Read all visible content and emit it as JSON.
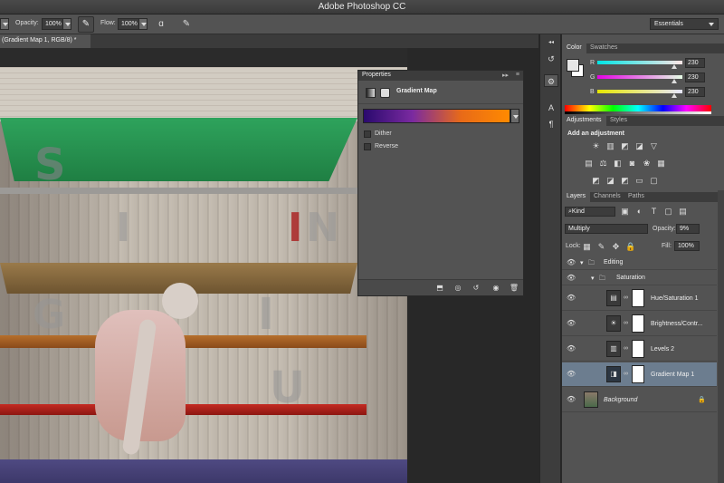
{
  "window": {
    "title": "Adobe Photoshop CC"
  },
  "options_bar": {
    "opacity_label": "Opacity:",
    "opacity_value": "100%",
    "flow_label": "Flow:",
    "flow_value": "100%",
    "workspace": "Essentials",
    "icons": [
      "airbrush-pressure-icon",
      "airbrush-icon",
      "tablet-size-icon"
    ]
  },
  "document": {
    "tab_label": "(Gradient Map 1, RGB/8) *"
  },
  "canvas": {
    "shelf_letters": [
      "S",
      "I",
      "N",
      "G",
      "I",
      "U"
    ],
    "colors": {
      "green_shelf": "#2ea35c",
      "red_shelf": "#c42a22",
      "floor": "#4f4a82"
    }
  },
  "properties": {
    "panel_title": "Properties",
    "adjustment_name": "Gradient Map",
    "gradient_colors": [
      "#2a0a6e",
      "#7a2aa0",
      "#e86a18",
      "#ff8a00"
    ],
    "dither_label": "Dither",
    "reverse_label": "Reverse",
    "dither_checked": false,
    "reverse_checked": false
  },
  "color_panel": {
    "tabs": [
      "Color",
      "Swatches"
    ],
    "channels": [
      {
        "label": "R",
        "value": "230",
        "gradient": [
          "#00e6e6",
          "#ffe6e6"
        ],
        "level": 0.9
      },
      {
        "label": "G",
        "value": "230",
        "gradient": [
          "#e600e6",
          "#e6ffe6"
        ],
        "level": 0.9
      },
      {
        "label": "B",
        "value": "230",
        "gradient": [
          "#e6e600",
          "#e6e6ff"
        ],
        "level": 0.9
      }
    ]
  },
  "adjustments_panel": {
    "tabs": [
      "Adjustments",
      "Styles"
    ],
    "title": "Add an adjustment"
  },
  "layers_panel": {
    "tabs": [
      "Layers",
      "Channels",
      "Paths"
    ],
    "filter_kind": "Kind",
    "blend_mode": "Multiply",
    "opacity_label": "Opacity:",
    "opacity_value": "9%",
    "lock_label": "Lock:",
    "fill_label": "Fill:",
    "fill_value": "100%",
    "layers": [
      {
        "name": "Editing",
        "type": "group"
      },
      {
        "name": "Saturation",
        "type": "group"
      },
      {
        "name": "Hue/Saturation 1",
        "type": "adjustment"
      },
      {
        "name": "Brightness/Contr...",
        "type": "adjustment"
      },
      {
        "name": "Levels 2",
        "type": "adjustment"
      },
      {
        "name": "Gradient Map 1",
        "type": "adjustment",
        "selected": true
      },
      {
        "name": "Background",
        "type": "image"
      }
    ]
  }
}
